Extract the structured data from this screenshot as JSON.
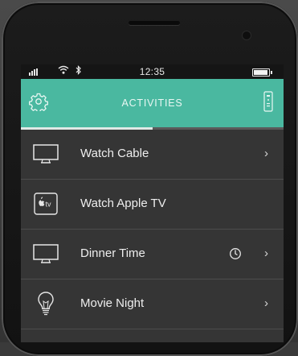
{
  "status_bar": {
    "time": "12:35",
    "wifi_icon": "wifi-icon",
    "bluetooth_icon": "bluetooth-icon",
    "battery_icon": "battery-icon",
    "signal_icon": "signal-icon"
  },
  "header": {
    "title": "ACTIVITIES",
    "left_icon": "gear-icon",
    "right_icon": "remote-icon",
    "background": "#4ab8a0"
  },
  "progress": {
    "fraction": 0.5
  },
  "activities": [
    {
      "label": "Watch Cable",
      "icon": "tv-icon",
      "has_timer": false,
      "has_chevron": true
    },
    {
      "label": "Watch Apple TV",
      "icon": "apple-tv-icon",
      "apple_tv_badge": "tv",
      "has_timer": false,
      "has_chevron": false
    },
    {
      "label": "Dinner Time",
      "icon": "tv-icon",
      "has_timer": true,
      "has_chevron": true
    },
    {
      "label": "Movie Night",
      "icon": "lightbulb-icon",
      "has_timer": false,
      "has_chevron": true
    }
  ],
  "chevron": "›"
}
